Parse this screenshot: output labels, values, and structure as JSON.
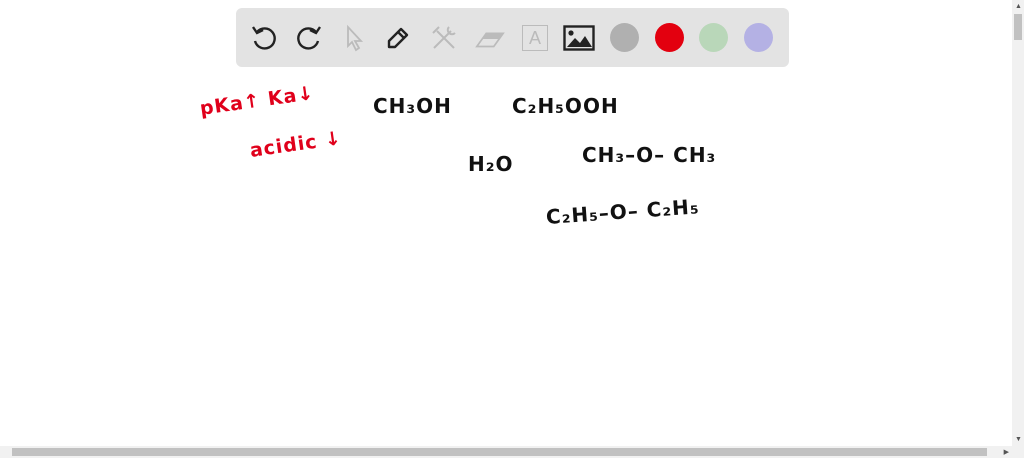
{
  "toolbar": {
    "tools": [
      {
        "name": "undo-icon"
      },
      {
        "name": "redo-icon"
      },
      {
        "name": "select-pointer-icon"
      },
      {
        "name": "pen-icon"
      },
      {
        "name": "tools-icon"
      },
      {
        "name": "eraser-icon"
      },
      {
        "name": "text-icon",
        "label": "A"
      },
      {
        "name": "image-icon"
      }
    ],
    "colors": [
      "#b0b0b0",
      "#e3000f",
      "#b9d7b9",
      "#b4b1e4"
    ]
  },
  "canvas": {
    "red_notes": [
      "pKa↑ Ka↓",
      "acidic ↓"
    ],
    "black_notes": [
      "CH₃OH",
      "C₂H₅OOH",
      "H₂O",
      "CH₃–O– CH₃",
      "C₂H₅–O– C₂H₅"
    ]
  },
  "scroll": {
    "up": "▲",
    "down": "▼",
    "right": "▶"
  }
}
